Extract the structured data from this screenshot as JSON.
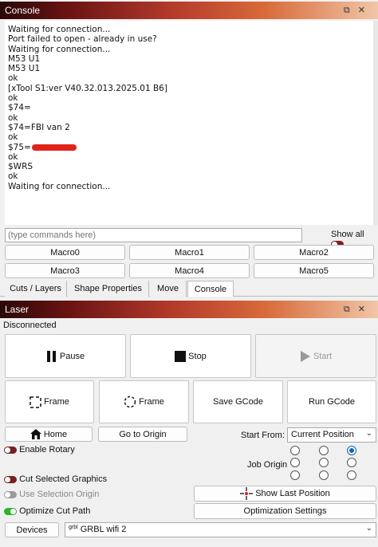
{
  "console_panel": {
    "title": "Console",
    "output_lines": [
      "Waiting for connection...",
      "Port failed to open - already in use?",
      "Waiting for connection...",
      "M53 U1",
      "M53 U1",
      "ok",
      "[xTool S1:ver V40.32.013.2025.01 B6]",
      "ok",
      "$74=",
      "ok",
      "$74=FBI van 2",
      "ok",
      "$75=",
      "ok",
      "$WRS",
      "ok",
      "Waiting for connection..."
    ],
    "command_placeholder": "(type commands here)",
    "show_all_label": "Show all",
    "macros": [
      "Macro0",
      "Macro1",
      "Macro2",
      "Macro3",
      "Macro4",
      "Macro5"
    ]
  },
  "tabs": [
    "Cuts / Layers",
    "Shape Properties",
    "Move",
    "Console"
  ],
  "laser_panel": {
    "title": "Laser",
    "status": "Disconnected",
    "pause_label": "Pause",
    "stop_label": "Stop",
    "start_label": "Start",
    "frame1_label": "Frame",
    "frame2_label": "Frame",
    "save_gcode_label": "Save GCode",
    "run_gcode_label": "Run GCode",
    "home_label": "Home",
    "go_origin_label": "Go to Origin",
    "start_from_label": "Start From:",
    "start_from_value": "Current Position",
    "enable_rotary_label": "Enable Rotary",
    "job_origin_label": "Job Origin",
    "cut_selected_label": "Cut Selected Graphics",
    "use_selection_origin_label": "Use Selection Origin",
    "optimize_cut_label": "Optimize Cut Path",
    "show_last_position_label": "Show Last Position",
    "optimization_settings_label": "Optimization Settings",
    "devices_label": "Devices",
    "device_prefix": "grbl",
    "device_value": "GRBL wifi 2"
  },
  "colors": {
    "accent_blue": "#1262b8",
    "toggle_off": "#7a2020",
    "toggle_on": "#2ab52a",
    "redaction": "#e0241b"
  }
}
